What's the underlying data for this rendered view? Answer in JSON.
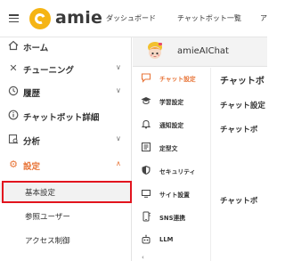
{
  "header": {
    "logo_text": "amie",
    "nav": [
      "ダッシュボード",
      "チャットボット一覧",
      "ア"
    ]
  },
  "sidebar": {
    "items": [
      {
        "label": "ホーム",
        "icon": "home-icon"
      },
      {
        "label": "チューニング",
        "icon": "tools-icon",
        "chevron": "∨"
      },
      {
        "label": "履歴",
        "icon": "history-icon",
        "chevron": "∨"
      },
      {
        "label": "チャットボット詳細",
        "icon": "info-icon"
      },
      {
        "label": "分析",
        "icon": "analytics-icon",
        "chevron": "∨"
      },
      {
        "label": "設定",
        "icon": "gear-icon",
        "chevron": "∧"
      }
    ],
    "sub_items": [
      "基本設定",
      "参照ユーザー",
      "アクセス制御"
    ]
  },
  "chat": {
    "title": "amieAIChat"
  },
  "sub_nav": {
    "items": [
      {
        "label": "チャット設定",
        "icon": "chat-icon"
      },
      {
        "label": "学習設定",
        "icon": "graduation-cap-icon"
      },
      {
        "label": "通知設定",
        "icon": "bell-icon"
      },
      {
        "label": "定型文",
        "icon": "template-icon"
      },
      {
        "label": "セキュリティ",
        "icon": "shield-icon"
      },
      {
        "label": "サイト設置",
        "icon": "monitor-icon"
      },
      {
        "label": "SNS連携",
        "icon": "phone-icon"
      },
      {
        "label": "LLM",
        "icon": "robot-icon"
      }
    ],
    "collapse_arrow": "‹"
  },
  "panel": {
    "title": "チャットボ",
    "fields": [
      "チャット設定",
      "チャットボ",
      "チャットボ"
    ]
  },
  "colors": {
    "accent": "#e8763a",
    "logo": "#f5b414",
    "highlight": "#e2141e"
  }
}
